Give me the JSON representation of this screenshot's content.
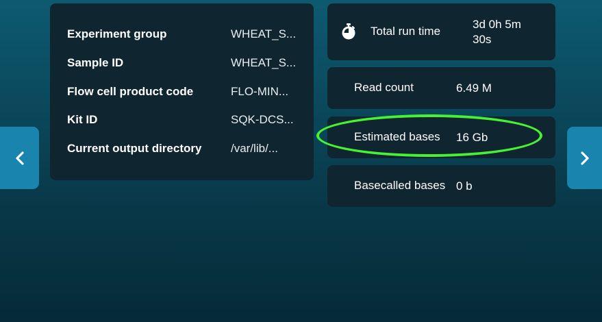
{
  "run_info": {
    "rows": [
      {
        "label": "Experiment group",
        "value": "WHEAT_S..."
      },
      {
        "label": "Sample ID",
        "value": "WHEAT_S..."
      },
      {
        "label": "Flow cell product code",
        "value": "FLO-MIN..."
      },
      {
        "label": "Kit ID",
        "value": "SQK-DCS..."
      },
      {
        "label": "Current output directory",
        "value": "/var/lib/..."
      }
    ]
  },
  "stats": {
    "run_time": {
      "icon": "stopwatch-icon",
      "label": "Total run time",
      "value_line1": "3d 0h 5m",
      "value_line2": "30s"
    },
    "read_count": {
      "label": "Read count",
      "value": "6.49 M"
    },
    "estimated_bases": {
      "label": "Estimated bases",
      "value": "16 Gb"
    },
    "basecalled_bases": {
      "label": "Basecalled bases",
      "value": "0 b"
    }
  },
  "navigation": {
    "prev_icon": "chevron-left-icon",
    "next_icon": "chevron-right-icon"
  },
  "colors": {
    "panel_bg": "#0f2530",
    "nav_button": "#1984ad",
    "highlight_ring": "#47f233"
  }
}
